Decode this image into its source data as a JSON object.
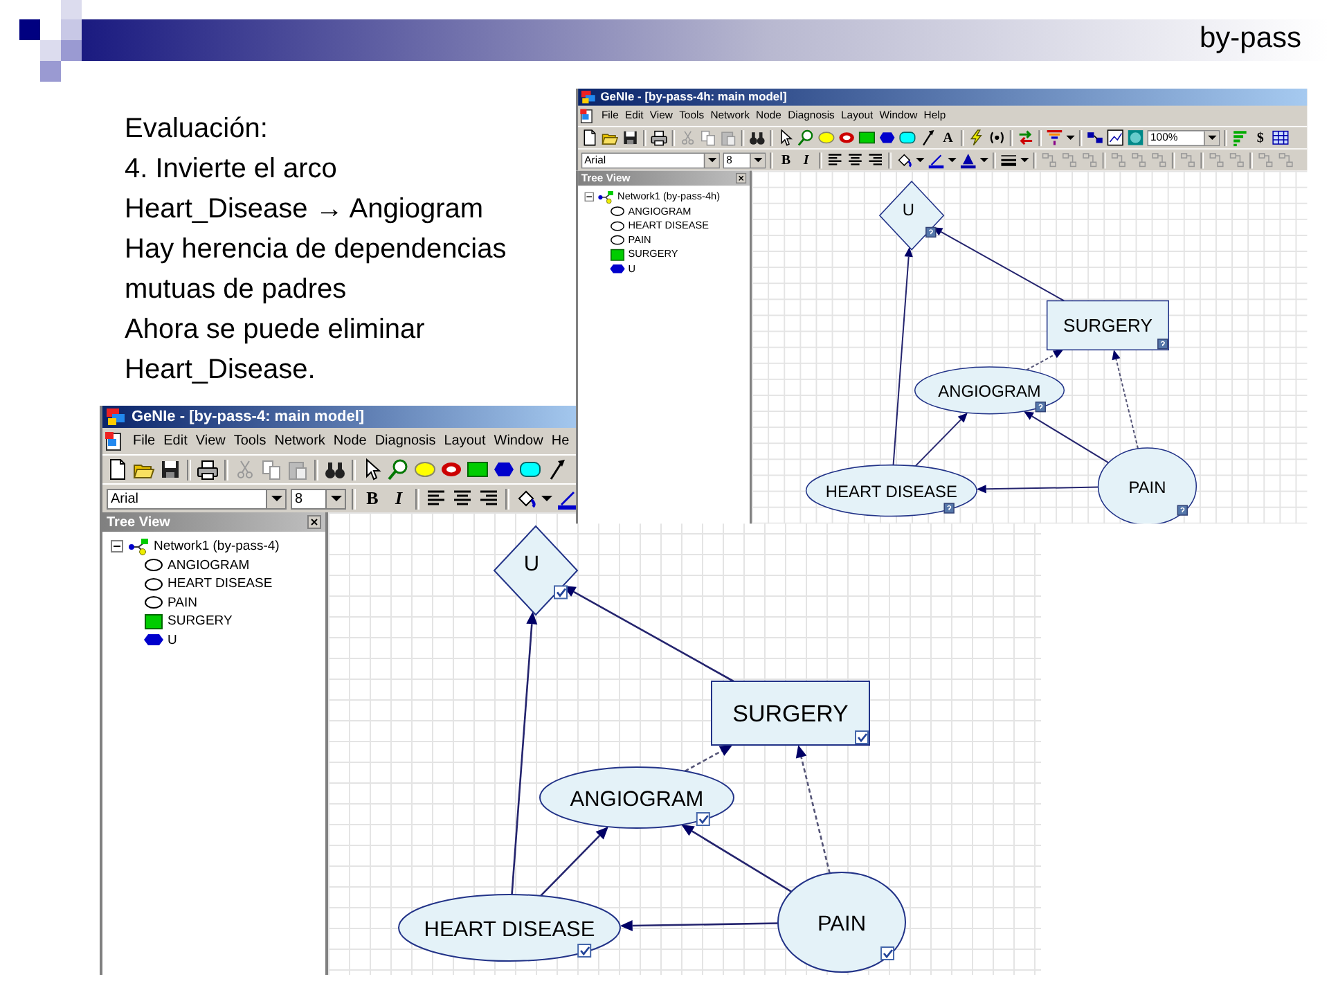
{
  "slide": {
    "title": "by-pass",
    "text_lines": [
      "Evaluación:",
      "4. Invierte el arco",
      "Heart_Disease → Angiogram",
      "Hay herencia de dependencias",
      "mutuas de padres",
      "Ahora se puede eliminar",
      "Heart_Disease."
    ]
  },
  "windows": [
    {
      "title": "GeNIe - [by-pass-4h: main model]",
      "menu": [
        "File",
        "Edit",
        "View",
        "Tools",
        "Network",
        "Node",
        "Diagnosis",
        "Layout",
        "Window",
        "Help"
      ],
      "toolbar": {
        "text_tool": "A",
        "zoom": "100%",
        "cost": "$"
      },
      "format_bar": {
        "font": "Arial",
        "size": "8",
        "bold": "B",
        "italic": "I"
      },
      "tree_view": {
        "title": "Tree View",
        "root": {
          "label": "Network1 (by-pass-4h)",
          "expanded": true,
          "children": [
            {
              "label": "ANGIOGRAM",
              "kind": "chance"
            },
            {
              "label": "HEART DISEASE",
              "kind": "chance"
            },
            {
              "label": "PAIN",
              "kind": "chance"
            },
            {
              "label": "SURGERY",
              "kind": "decision"
            },
            {
              "label": "U",
              "kind": "utility"
            }
          ]
        }
      },
      "diagram": {
        "nodes": [
          {
            "label": "U",
            "kind": "utility",
            "updated": false
          },
          {
            "label": "SURGERY",
            "kind": "decision",
            "updated": false
          },
          {
            "label": "ANGIOGRAM",
            "kind": "chance",
            "updated": false
          },
          {
            "label": "HEART DISEASE",
            "kind": "chance",
            "updated": false
          },
          {
            "label": "PAIN",
            "kind": "chance",
            "updated": false
          }
        ],
        "arcs": [
          {
            "dashed": false
          },
          {
            "dashed": false
          },
          {
            "dashed": true
          },
          {
            "dashed": true
          },
          {
            "dashed": false
          },
          {
            "dashed": false
          },
          {
            "dashed": false
          }
        ]
      }
    },
    {
      "title": "GeNIe - [by-pass-4: main model]",
      "menu": [
        "File",
        "Edit",
        "View",
        "Tools",
        "Network",
        "Node",
        "Diagnosis",
        "Layout",
        "Window",
        "He"
      ],
      "format_bar": {
        "font": "Arial",
        "size": "8",
        "bold": "B",
        "italic": "I"
      },
      "tree_view": {
        "title": "Tree View",
        "root": {
          "label": "Network1 (by-pass-4)",
          "expanded": true,
          "children": [
            {
              "label": "ANGIOGRAM",
              "kind": "chance"
            },
            {
              "label": "HEART DISEASE",
              "kind": "chance"
            },
            {
              "label": "PAIN",
              "kind": "chance"
            },
            {
              "label": "SURGERY",
              "kind": "decision"
            },
            {
              "label": "U",
              "kind": "utility"
            }
          ]
        }
      },
      "diagram": {
        "nodes": [
          {
            "label": "U",
            "kind": "utility",
            "updated": true
          },
          {
            "label": "SURGERY",
            "kind": "decision",
            "updated": true
          },
          {
            "label": "ANGIOGRAM",
            "kind": "chance",
            "updated": true
          },
          {
            "label": "HEART DISEASE",
            "kind": "chance",
            "updated": true
          },
          {
            "label": "PAIN",
            "kind": "chance",
            "updated": true
          }
        ],
        "arcs": [
          {
            "dashed": false
          },
          {
            "dashed": false
          },
          {
            "dashed": true
          },
          {
            "dashed": true
          },
          {
            "dashed": false
          },
          {
            "dashed": false
          },
          {
            "dashed": false
          }
        ]
      }
    }
  ]
}
